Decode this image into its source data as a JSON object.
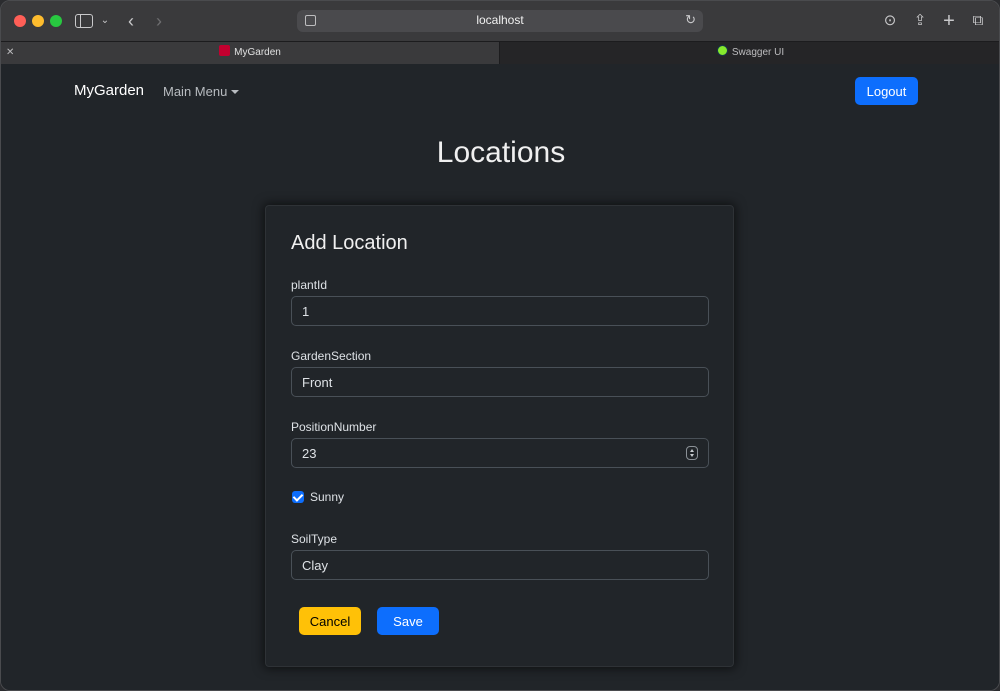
{
  "browser": {
    "url": "localhost",
    "tabs": [
      {
        "label": "MyGarden",
        "active": true
      },
      {
        "label": "Swagger UI",
        "active": false
      }
    ]
  },
  "navbar": {
    "brand": "MyGarden",
    "menu_label": "Main Menu",
    "logout_label": "Logout"
  },
  "page": {
    "title": "Locations"
  },
  "form": {
    "title": "Add Location",
    "fields": {
      "plant_id": {
        "label": "plantId",
        "value": "1"
      },
      "garden_section": {
        "label": "GardenSection",
        "value": "Front"
      },
      "position_number": {
        "label": "PositionNumber",
        "value": "23"
      },
      "sunny": {
        "label": "Sunny",
        "checked": true
      },
      "soil_type": {
        "label": "SoilType",
        "value": "Clay"
      }
    },
    "cancel_label": "Cancel",
    "save_label": "Save"
  },
  "colors": {
    "primary": "#0d6efd",
    "warning": "#ffc107",
    "background": "#212529"
  }
}
